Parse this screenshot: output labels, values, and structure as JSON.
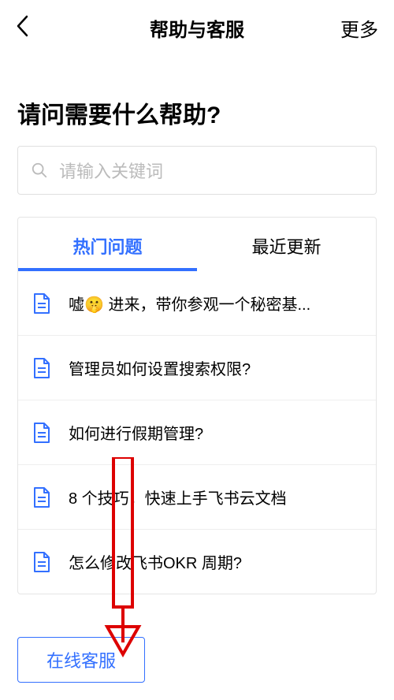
{
  "header": {
    "title": "帮助与客服",
    "more": "更多"
  },
  "page_title": "请问需要什么帮助?",
  "search": {
    "placeholder": "请输入关键词"
  },
  "tabs": {
    "hot": "热门问题",
    "recent": "最近更新"
  },
  "list": {
    "items": [
      {
        "text": "嘘🤫 进来，带你参观一个秘密基..."
      },
      {
        "text": "管理员如何设置搜索权限?"
      },
      {
        "text": "如何进行假期管理?"
      },
      {
        "text": "8 个技巧，快速上手飞书云文档"
      },
      {
        "text": "怎么修改飞书OKR 周期?"
      }
    ]
  },
  "online_service_label": "在线客服"
}
